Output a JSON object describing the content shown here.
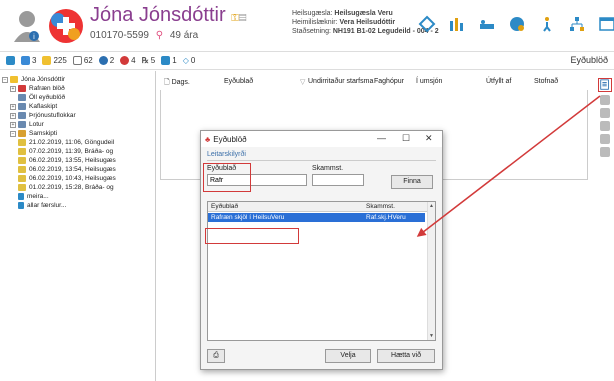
{
  "header": {
    "patient_name": "Jóna Jónsdóttir",
    "patient_id": "010170-5599",
    "age": "49 ára",
    "facility_label": "Heilsugæsla:",
    "facility_value": "Heilsugæsla Veru",
    "doctor_label": "Heimilislæknir:",
    "doctor_value": "Vera Heilsudóttir",
    "location_label": "Staðsetning:",
    "location_value": "NH191 B1-02 Legudeild - 004 - 2"
  },
  "toolbar": {
    "items": [
      {
        "icon": "calendar-icon",
        "count": ""
      },
      {
        "icon": "people-icon",
        "count": "3"
      },
      {
        "icon": "note-icon",
        "count": "225"
      },
      {
        "icon": "mail-icon",
        "count": "62"
      },
      {
        "icon": "info-icon",
        "count": "2"
      },
      {
        "icon": "alert-icon",
        "count": "4"
      },
      {
        "icon": "rx-icon",
        "count": "5"
      },
      {
        "icon": "person-icon",
        "count": "1"
      },
      {
        "icon": "diamond-icon",
        "count": "0"
      }
    ],
    "right_label": "Eyðublöð"
  },
  "tree": {
    "root": "Jóna Jónsdóttir",
    "items": [
      {
        "label": "Rafræn blöð",
        "level": 1,
        "exp": "+"
      },
      {
        "label": "Öll eyðublöð",
        "level": 1,
        "exp": ""
      },
      {
        "label": "Kaflaskipt",
        "level": 1,
        "exp": "+"
      },
      {
        "label": "Þrjónustuflokkar",
        "level": 1,
        "exp": "+"
      },
      {
        "label": "Lotur",
        "level": 1,
        "exp": "+"
      },
      {
        "label": "Samskipti",
        "level": 1,
        "exp": "−"
      },
      {
        "label": "21.02.2019, 11:06, Göngudeil",
        "level": 2,
        "exp": ""
      },
      {
        "label": "07.02.2019, 11:39, Bráða- og",
        "level": 2,
        "exp": ""
      },
      {
        "label": "06.02.2019, 13:55, Heilsugæs",
        "level": 2,
        "exp": ""
      },
      {
        "label": "06.02.2019, 13:54, Heilsugæs",
        "level": 2,
        "exp": ""
      },
      {
        "label": "06.02.2019, 10:43, Heilsugæs",
        "level": 2,
        "exp": ""
      },
      {
        "label": "01.02.2019, 15:28, Bráða- og",
        "level": 2,
        "exp": ""
      },
      {
        "label": "meira...",
        "level": 2,
        "exp": ""
      },
      {
        "label": "allar færslur...",
        "level": 2,
        "exp": ""
      }
    ]
  },
  "columns": [
    "Dags.",
    "Eyðublað",
    "Undirritaður starfsma",
    "Faghópur",
    "Í umsjón",
    "Útfyllt af",
    "Stofnað"
  ],
  "dialog": {
    "title": "Eyðublöð",
    "section": "Leitarskilyrði",
    "form_label": "Eyðublað",
    "form_value": "Rafr",
    "abbr_label": "Skammst.",
    "abbr_value": "",
    "find_button": "Finna",
    "result_col1": "Eyðublað",
    "result_col2": "Skammst.",
    "result_row_name": "Rafræn skjöl í HeilsuVeru",
    "result_row_abbr": "Raf.skj.HVeru",
    "select_button": "Velja",
    "cancel_button": "Hætta við"
  }
}
